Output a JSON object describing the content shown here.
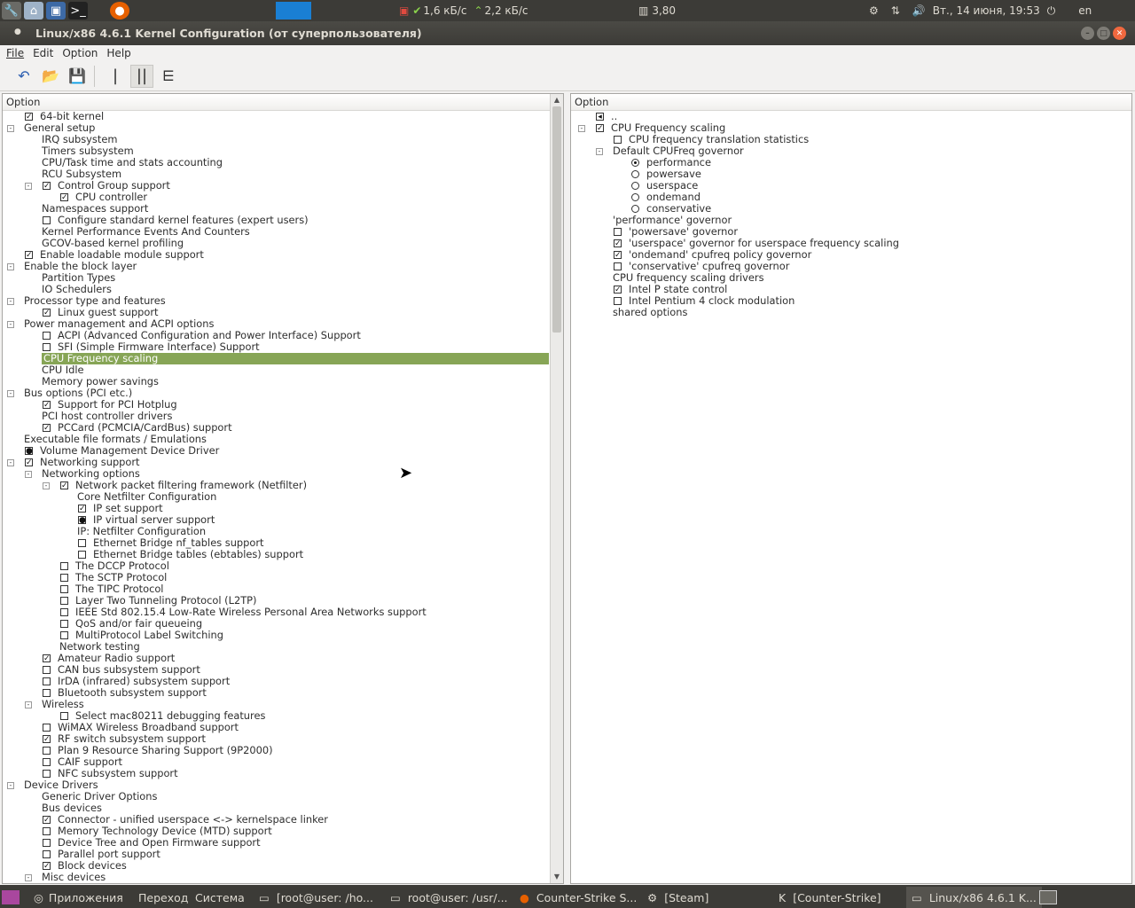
{
  "topbar": {
    "network_down": "1,6 кБ/с",
    "network_up": "2,2 кБ/с",
    "cpu_load": "3,80",
    "datetime": "Вт., 14 июня, 19:53",
    "keyboard_layout": "en"
  },
  "window": {
    "title": "Linux/x86 4.6.1 Kernel Configuration (от суперпользователя)"
  },
  "menu": {
    "file": "File",
    "edit": "Edit",
    "option": "Option",
    "help": "Help"
  },
  "left_panel": {
    "header": "Option",
    "rows": [
      {
        "l": "64-bit kernel",
        "i": 0,
        "c": "y"
      },
      {
        "l": "General setup",
        "i": 0,
        "e": "-"
      },
      {
        "l": "IRQ subsystem",
        "i": 1
      },
      {
        "l": "Timers subsystem",
        "i": 1
      },
      {
        "l": "CPU/Task time and stats accounting",
        "i": 1
      },
      {
        "l": "RCU Subsystem",
        "i": 1
      },
      {
        "l": "Control Group support",
        "i": 1,
        "c": "y",
        "e": "-"
      },
      {
        "l": "CPU controller",
        "i": 2,
        "c": "y"
      },
      {
        "l": "Namespaces support",
        "i": 1
      },
      {
        "l": "Configure standard kernel features (expert users)",
        "i": 1,
        "c": "n"
      },
      {
        "l": "Kernel Performance Events And Counters",
        "i": 1
      },
      {
        "l": "GCOV-based kernel profiling",
        "i": 1
      },
      {
        "l": "Enable loadable module support",
        "i": 0,
        "c": "y"
      },
      {
        "l": "Enable the block layer",
        "i": 0,
        "e": "-"
      },
      {
        "l": "Partition Types",
        "i": 1
      },
      {
        "l": "IO Schedulers",
        "i": 1
      },
      {
        "l": "Processor type and features",
        "i": 0,
        "e": "-"
      },
      {
        "l": "Linux guest support",
        "i": 1,
        "c": "y"
      },
      {
        "l": "Power management and ACPI options",
        "i": 0,
        "e": "-"
      },
      {
        "l": "ACPI (Advanced Configuration and Power Interface) Support",
        "i": 1,
        "c": "n"
      },
      {
        "l": "SFI (Simple Firmware Interface) Support",
        "i": 1,
        "c": "n"
      },
      {
        "l": "CPU Frequency scaling",
        "i": 1,
        "s": true
      },
      {
        "l": "CPU Idle",
        "i": 1
      },
      {
        "l": "Memory power savings",
        "i": 1
      },
      {
        "l": "Bus options (PCI etc.)",
        "i": 0,
        "e": "-"
      },
      {
        "l": "Support for PCI Hotplug",
        "i": 1,
        "c": "y"
      },
      {
        "l": "PCI host controller drivers",
        "i": 1
      },
      {
        "l": "PCCard (PCMCIA/CardBus) support",
        "i": 1,
        "c": "y"
      },
      {
        "l": "Executable file formats / Emulations",
        "i": 0
      },
      {
        "l": "Volume Management Device Driver",
        "i": 0,
        "c": "m"
      },
      {
        "l": "Networking support",
        "i": 0,
        "c": "y",
        "e": "-"
      },
      {
        "l": "Networking options",
        "i": 1,
        "e": "-"
      },
      {
        "l": "Network packet filtering framework (Netfilter)",
        "i": 2,
        "c": "y",
        "e": "-"
      },
      {
        "l": "Core Netfilter Configuration",
        "i": 3
      },
      {
        "l": "IP set support",
        "i": 3,
        "c": "y"
      },
      {
        "l": "IP virtual server support",
        "i": 3,
        "c": "m"
      },
      {
        "l": "IP: Netfilter Configuration",
        "i": 3
      },
      {
        "l": "Ethernet Bridge nf_tables support",
        "i": 3,
        "c": "n"
      },
      {
        "l": "Ethernet Bridge tables (ebtables) support",
        "i": 3,
        "c": "n"
      },
      {
        "l": "The DCCP Protocol",
        "i": 2,
        "c": "n"
      },
      {
        "l": "The SCTP Protocol",
        "i": 2,
        "c": "n"
      },
      {
        "l": "The TIPC Protocol",
        "i": 2,
        "c": "n"
      },
      {
        "l": "Layer Two Tunneling Protocol (L2TP)",
        "i": 2,
        "c": "n"
      },
      {
        "l": "IEEE Std 802.15.4 Low-Rate Wireless Personal Area Networks support",
        "i": 2,
        "c": "n"
      },
      {
        "l": "QoS and/or fair queueing",
        "i": 2,
        "c": "n"
      },
      {
        "l": "MultiProtocol Label Switching",
        "i": 2,
        "c": "n"
      },
      {
        "l": "Network testing",
        "i": 2
      },
      {
        "l": "Amateur Radio support",
        "i": 1,
        "c": "y"
      },
      {
        "l": "CAN bus subsystem support",
        "i": 1,
        "c": "n"
      },
      {
        "l": "IrDA (infrared) subsystem support",
        "i": 1,
        "c": "n"
      },
      {
        "l": "Bluetooth subsystem support",
        "i": 1,
        "c": "n"
      },
      {
        "l": "Wireless",
        "i": 1,
        "e": "-"
      },
      {
        "l": "Select mac80211 debugging features",
        "i": 2,
        "c": "n"
      },
      {
        "l": "WiMAX Wireless Broadband support",
        "i": 1,
        "c": "n"
      },
      {
        "l": "RF switch subsystem support",
        "i": 1,
        "c": "y"
      },
      {
        "l": "Plan 9 Resource Sharing Support (9P2000)",
        "i": 1,
        "c": "n"
      },
      {
        "l": "CAIF support",
        "i": 1,
        "c": "n"
      },
      {
        "l": "NFC subsystem support",
        "i": 1,
        "c": "n"
      },
      {
        "l": "Device Drivers",
        "i": 0,
        "e": "-"
      },
      {
        "l": "Generic Driver Options",
        "i": 1
      },
      {
        "l": "Bus devices",
        "i": 1
      },
      {
        "l": "Connector - unified userspace <-> kernelspace linker",
        "i": 1,
        "c": "y"
      },
      {
        "l": "Memory Technology Device (MTD) support",
        "i": 1,
        "c": "n"
      },
      {
        "l": "Device Tree and Open Firmware support",
        "i": 1,
        "c": "n"
      },
      {
        "l": "Parallel port support",
        "i": 1,
        "c": "n"
      },
      {
        "l": "Block devices",
        "i": 1,
        "c": "y"
      },
      {
        "l": "Misc devices",
        "i": 1,
        "e": "-"
      }
    ]
  },
  "right_panel": {
    "header": "Option",
    "rows": [
      {
        "l": "..",
        "i": 0,
        "c": "b"
      },
      {
        "l": "CPU Frequency scaling",
        "i": 0,
        "c": "y",
        "e": "-"
      },
      {
        "l": "CPU frequency translation statistics",
        "i": 1,
        "c": "n"
      },
      {
        "l": "Default CPUFreq governor",
        "i": 1,
        "e": "-"
      },
      {
        "l": "performance",
        "i": 2,
        "r": "on"
      },
      {
        "l": "powersave",
        "i": 2,
        "r": "off"
      },
      {
        "l": "userspace",
        "i": 2,
        "r": "off"
      },
      {
        "l": "ondemand",
        "i": 2,
        "r": "off"
      },
      {
        "l": "conservative",
        "i": 2,
        "r": "off"
      },
      {
        "l": "'performance' governor",
        "i": 1
      },
      {
        "l": "'powersave' governor",
        "i": 1,
        "c": "n"
      },
      {
        "l": "'userspace' governor for userspace frequency scaling",
        "i": 1,
        "c": "y"
      },
      {
        "l": "'ondemand' cpufreq policy governor",
        "i": 1,
        "c": "y"
      },
      {
        "l": "'conservative' cpufreq governor",
        "i": 1,
        "c": "n"
      },
      {
        "l": "CPU frequency scaling drivers",
        "i": 1
      },
      {
        "l": "Intel P state control",
        "i": 1,
        "c": "y"
      },
      {
        "l": "Intel Pentium 4 clock modulation",
        "i": 1,
        "c": "n"
      },
      {
        "l": "shared options",
        "i": 1
      }
    ]
  },
  "taskbar": {
    "apps": "Приложения",
    "places": "Переход",
    "system": "Система",
    "t1": "[root@user: /ho...",
    "t2": "root@user: /usr/...",
    "t3": "Counter-Strike S...",
    "t4": "[Steam]",
    "t5": "[Counter-Strike]",
    "t6": "Linux/x86 4.6.1 K..."
  },
  "colors": {
    "selection": "#87a556",
    "panel_bg": "#3c3b37",
    "close": "#f0683f"
  },
  "icons": [
    "undo-icon",
    "open-folder-icon",
    "save-icon",
    "single-view-icon",
    "split-view-icon",
    "full-view-icon",
    "network-icon",
    "volume-icon",
    "power-icon",
    "firefox-icon",
    "steam-icon"
  ]
}
